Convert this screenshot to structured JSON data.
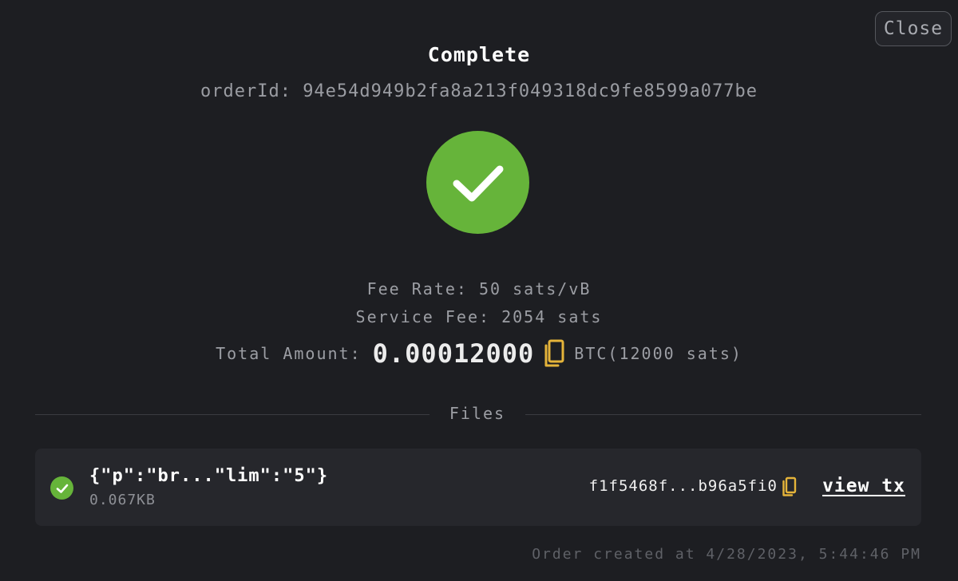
{
  "header": {
    "title": "Complete",
    "close_label": "Close",
    "order_id": "orderId: 94e54d949b2fa8a213f049318dc9fe8599a077be"
  },
  "status": {
    "icon": "checkmark-icon",
    "color": "#66b43a"
  },
  "fees": {
    "fee_rate": "Fee Rate: 50 sats/vB",
    "service_fee": "Service Fee: 2054 sats",
    "total_label": "Total Amount:",
    "total_value": "0.00012000",
    "total_unit": "BTC(12000 sats)"
  },
  "files_section": {
    "label": "Files",
    "items": [
      {
        "name": "{\"p\":\"br...\"lim\":\"5\"}",
        "size": "0.067KB",
        "tx_id": "f1f5468f...b96a5fi0",
        "link_label": "view tx"
      }
    ]
  },
  "footer": {
    "created_at": "Order created at 4/28/2023, 5:44:46 PM"
  },
  "colors": {
    "accent_green": "#66b43a",
    "copy_icon": "#e5b43a",
    "background": "#1d1e22"
  }
}
